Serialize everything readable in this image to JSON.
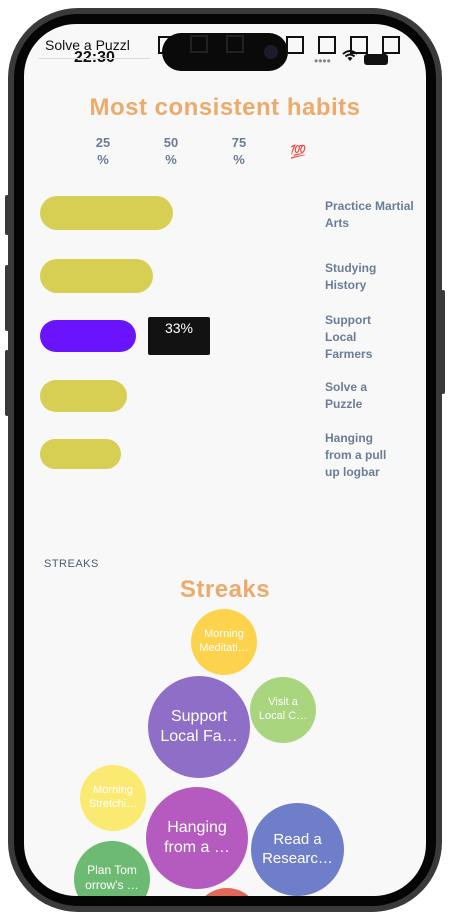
{
  "status_bar": {
    "app_label": "Solve a Puzzl",
    "time": "22:30"
  },
  "habits": {
    "title": "Most consistent habits",
    "percent_ticks": [
      {
        "value": "25",
        "unit": "%"
      },
      {
        "value": "50",
        "unit": "%"
      },
      {
        "value": "75",
        "unit": "%"
      },
      {
        "value": "💯",
        "unit": ""
      }
    ],
    "tooltip": "33%",
    "items": [
      {
        "label": "Practice Martial Arts",
        "color": "#d6cf54",
        "fraction": 0.46
      },
      {
        "label": "Studying History",
        "color": "#d6cf54",
        "fraction": 0.39
      },
      {
        "label": "Support Local Farmers",
        "color": "#6a13fe",
        "fraction": 0.33
      },
      {
        "label": "Solve a Puzzle",
        "color": "#d6cf54",
        "fraction": 0.3
      },
      {
        "label": "Hanging from a pull up logbar",
        "color": "#d6cf54",
        "fraction": 0.28
      }
    ]
  },
  "streaks": {
    "section_tag": "STREAKS",
    "title": "Streaks",
    "bubbles": [
      {
        "label": "Morning Meditati…",
        "color": "#fdd24d"
      },
      {
        "label": "Support Local Fa…",
        "color": "#8f6ec7"
      },
      {
        "label": "Visit a Local C…",
        "color": "#a8d57e"
      },
      {
        "label": "Morning Stretchi…",
        "color": "#fbea72"
      },
      {
        "label": "Hanging from a …",
        "color": "#b55bbf"
      },
      {
        "label": "Read a Researc…",
        "color": "#6f7ec8"
      },
      {
        "label": "Plan Tom orrow's …",
        "color": "#6dbb72"
      },
      {
        "label": "",
        "color": "#e2685a"
      }
    ]
  }
}
